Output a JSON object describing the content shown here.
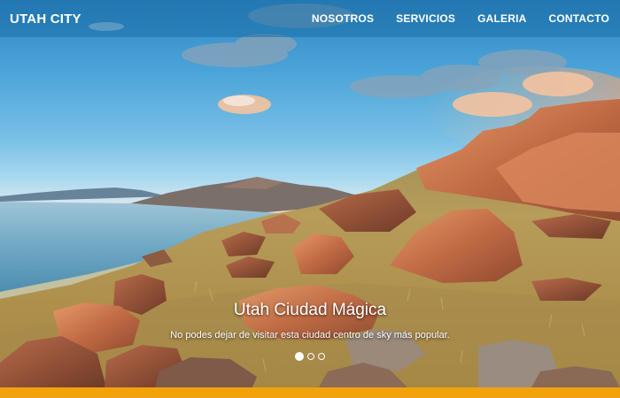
{
  "header": {
    "brand": "UTAH CITY",
    "nav": [
      {
        "label": "NOSOTROS"
      },
      {
        "label": "SERVICIOS"
      },
      {
        "label": "GALERIA"
      },
      {
        "label": "CONTACTO"
      }
    ]
  },
  "hero": {
    "title": "Utah Ciudad Mágica",
    "subtitle": "No podes dejar de visitar esta ciudad centro de sky más popular.",
    "slides_total": 3,
    "active_slide": 1
  },
  "colors": {
    "nav_bar": "#196ea5",
    "accent": "#f2a20c",
    "text": "#ffffff"
  }
}
